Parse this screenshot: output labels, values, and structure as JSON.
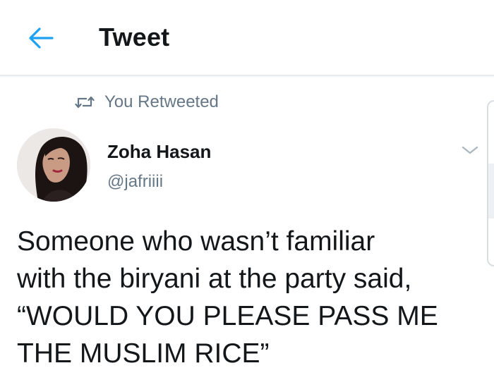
{
  "header": {
    "title": "Tweet"
  },
  "retweet": {
    "label": "You Retweeted"
  },
  "author": {
    "name": "Zoha Hasan",
    "handle": "@jafriiii"
  },
  "tweet": {
    "text": "Someone who wasn’t familiar\nwith the biryani at the party said,\n“WOULD YOU PLEASE PASS ME\nTHE MUSLIM RICE”"
  },
  "icons": {
    "back": "back-arrow-icon",
    "retweet": "retweet-icon",
    "caret": "chevron-down-icon"
  },
  "colors": {
    "accent": "#1da1f2",
    "secondary_text": "#657786",
    "primary_text": "#14171a"
  }
}
